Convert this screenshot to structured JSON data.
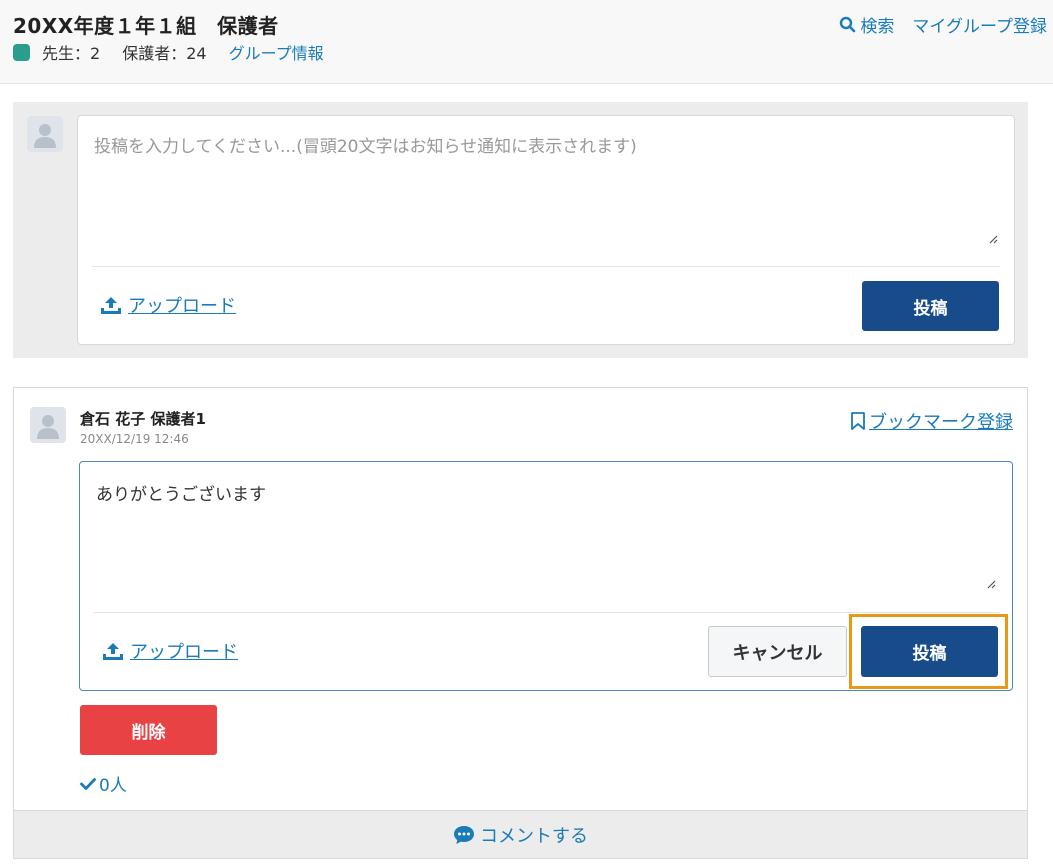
{
  "header": {
    "title": "20XX年度１年１組　保護者",
    "teachers": "先生：2",
    "guardians": "保護者：24",
    "group_info_link": "グループ情報",
    "search_link": "検索",
    "mygroup_link": "マイグループ登録",
    "dot_color": "#2a9d8f"
  },
  "compose": {
    "placeholder": "投稿を入力してください...(冒頭20文字はお知らせ通知に表示されます)",
    "upload_label": "アップロード",
    "submit_label": "投稿"
  },
  "post": {
    "author": "倉石 花子 保護者1",
    "timestamp": "20XX/12/19 12:46",
    "bookmark_label": "ブックマーク登録",
    "reply_text": "ありがとうございます",
    "upload_label": "アップロード",
    "cancel_label": "キャンセル",
    "submit_label": "投稿",
    "delete_label": "削除",
    "likes_label": "0人",
    "comment_label": "コメントする"
  },
  "colors": {
    "primary": "#174b8a",
    "danger": "#e84245",
    "link": "#1a7bb9",
    "highlight": "#e69a14"
  }
}
